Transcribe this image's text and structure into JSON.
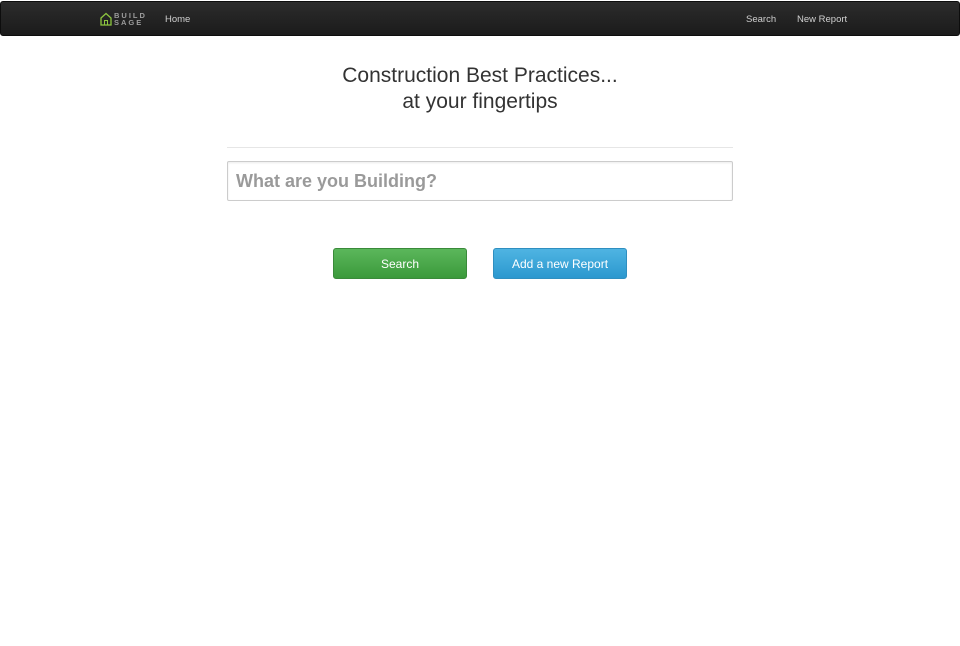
{
  "navbar": {
    "brand": {
      "line1": "BUILD",
      "line2": "SAGE",
      "icon": "house-icon",
      "icon_color": "#8dc63f"
    },
    "links": {
      "home": "Home",
      "search": "Search",
      "new_report": "New Report"
    }
  },
  "hero": {
    "line1": "Construction Best Practices...",
    "line2": "at your fingertips"
  },
  "search": {
    "placeholder": "What are you Building?",
    "value": ""
  },
  "actions": {
    "search_label": "Search",
    "add_label": "Add a new Report",
    "search_color": "#4cae4c",
    "add_color": "#3aa8db"
  }
}
